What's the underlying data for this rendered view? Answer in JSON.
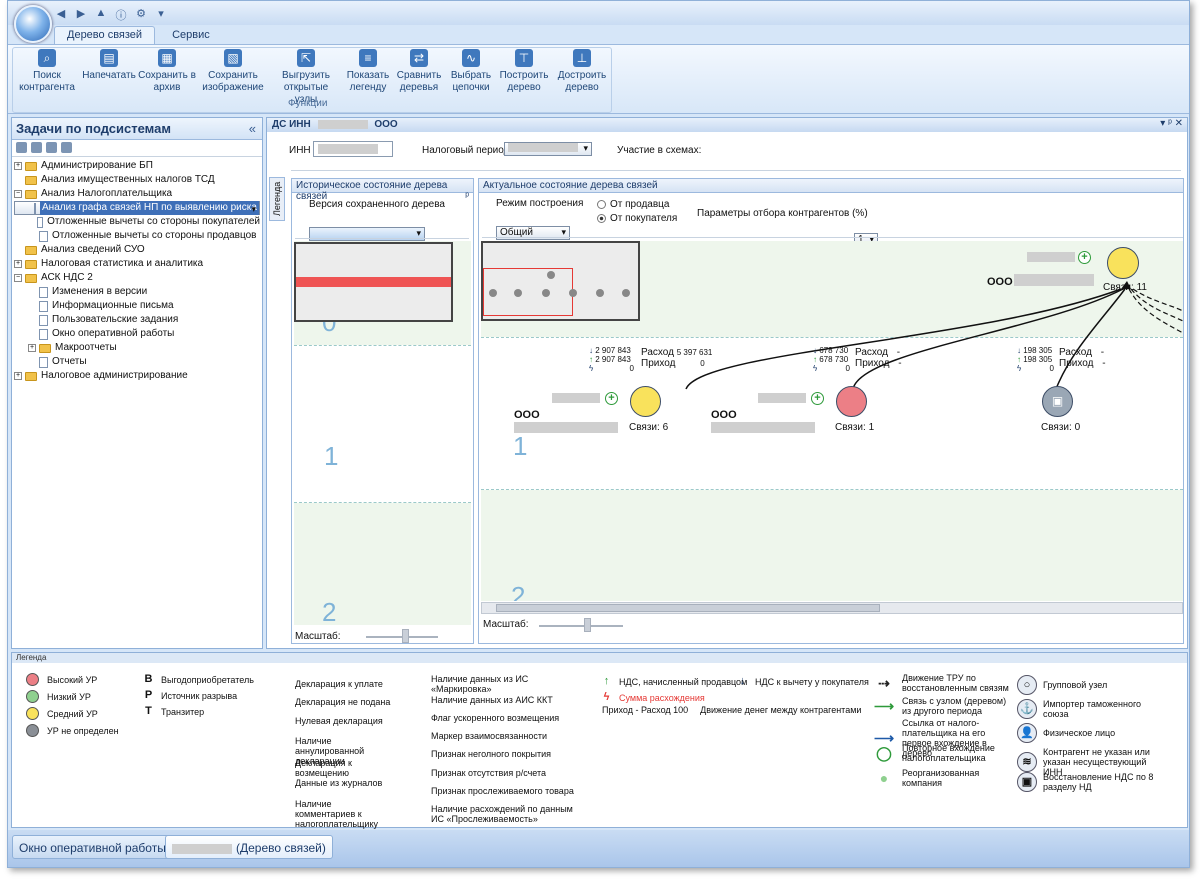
{
  "ribbon": {
    "tabs": [
      "Дерево связей",
      "Сервис"
    ],
    "buttons": [
      {
        "label": "Поиск контрагента",
        "icon": "search-icon"
      },
      {
        "label": "Напечатать",
        "icon": "print-icon"
      },
      {
        "label": "Сохранить в архив",
        "icon": "archive-icon"
      },
      {
        "label": "Сохранить изображение",
        "icon": "image-icon"
      },
      {
        "label": "Выгрузить открытые узлы",
        "icon": "export-nodes-icon"
      },
      {
        "label": "Показать легенду",
        "icon": "legend-icon"
      },
      {
        "label": "Сравнить деревья",
        "icon": "compare-icon"
      },
      {
        "label": "Выбрать цепочки",
        "icon": "chain-icon"
      },
      {
        "label": "Построить дерево",
        "icon": "build-tree-icon"
      },
      {
        "label": "Достроить дерево",
        "icon": "extend-tree-icon"
      }
    ],
    "group_name": "Функции"
  },
  "sidebar": {
    "title": "Задачи по подсистемам",
    "collapse": "«",
    "tree": [
      {
        "label": "Администрирование БП",
        "level": 0,
        "type": "folder",
        "exp": "+"
      },
      {
        "label": "Анализ имущественных налогов ТСД",
        "level": 0,
        "type": "folder",
        "exp": ""
      },
      {
        "label": "Анализ Налогоплательщика",
        "level": 0,
        "type": "folder",
        "exp": "−"
      },
      {
        "label": "Анализ графа связей НП по выявлению риска",
        "level": 1,
        "type": "doc",
        "exp": "",
        "selected": true
      },
      {
        "label": "Отложенные вычеты со стороны покупателей",
        "level": 1,
        "type": "doc",
        "exp": ""
      },
      {
        "label": "Отложенные вычеты со стороны продавцов",
        "level": 1,
        "type": "doc",
        "exp": ""
      },
      {
        "label": "Анализ сведений СУО",
        "level": 0,
        "type": "folder",
        "exp": ""
      },
      {
        "label": "Налоговая статистика и аналитика",
        "level": 0,
        "type": "folder",
        "exp": "+"
      },
      {
        "label": "АСК НДС 2",
        "level": 0,
        "type": "folder",
        "exp": "−"
      },
      {
        "label": "Изменения в версии",
        "level": 1,
        "type": "doc",
        "exp": ""
      },
      {
        "label": "Информационные письма",
        "level": 1,
        "type": "doc",
        "exp": ""
      },
      {
        "label": "Пользовательские задания",
        "level": 1,
        "type": "doc",
        "exp": ""
      },
      {
        "label": "Окно оперативной работы",
        "level": 1,
        "type": "doc",
        "exp": ""
      },
      {
        "label": "Макроотчеты",
        "level": 1,
        "type": "folder",
        "exp": "+"
      },
      {
        "label": "Отчеты",
        "level": 1,
        "type": "doc",
        "exp": ""
      },
      {
        "label": "Налоговое администрирование",
        "level": 0,
        "type": "folder",
        "exp": "+"
      }
    ]
  },
  "document": {
    "title": "ДС ИНН",
    "title_org": "ООО",
    "controls": "▾ ᵖ ✕",
    "inn_label": "ИНН",
    "period_label": "Налоговый период",
    "schemes_label": "Участие в схемах:",
    "legend_tab": "Легенда",
    "history_title": "Историческое состояние дерева связей",
    "history_pin": "ᵖ",
    "saved_version_label": "Версия сохраненного дерева",
    "current_title": "Актуальное состояние дерева связей",
    "mode_label": "Режим построения",
    "mode_value": "Общий",
    "radio_seller": "От продавца",
    "radio_buyer": "От покупателя",
    "params_label": "Параметры отбора контрагентов (%)",
    "params_value": "1",
    "scale_label": "Масштаб:",
    "level_1": "1",
    "level_2": "2",
    "level_0": "0"
  },
  "graph": {
    "root": {
      "org": "ООО",
      "links": "Связи: 11",
      "color": "#f9e25c"
    },
    "nodes": [
      {
        "org": "ООО",
        "links": "Связи: 6",
        "color": "#f9e25c",
        "v1": "2 907 843",
        "v2": "2 907 843",
        "v3": "0",
        "rashod_label": "Расход",
        "prihod_label": "Приход",
        "rashod": "5 397 631",
        "prihod": "0"
      },
      {
        "org": "ООО",
        "links": "Связи: 1",
        "color": "#ec7f86",
        "v1": "678 730",
        "v2": "678 730",
        "v3": "0",
        "rashod_label": "Расход",
        "prihod_label": "Приход",
        "rashod": "-",
        "prihod": "-"
      },
      {
        "org": "",
        "links": "Связи: 0",
        "color": "#9aa7b5",
        "v1": "198 305",
        "v2": "198 305",
        "v3": "0",
        "rashod_label": "Расход",
        "prihod_label": "Приход",
        "rashod": "-",
        "prihod": "-"
      }
    ]
  },
  "legend": {
    "title": "Легенда",
    "risk": [
      {
        "label": "Высокий УР",
        "color": "#ec7f86"
      },
      {
        "label": "Низкий УР",
        "color": "#8fd08f"
      },
      {
        "label": "Средний УР",
        "color": "#f9e25c"
      },
      {
        "label": "УР не определен",
        "color": "#8a8f96"
      }
    ],
    "roles": [
      {
        "letter": "B",
        "label": "Выгодоприобретатель"
      },
      {
        "letter": "P",
        "label": "Источник разрыва"
      },
      {
        "letter": "T",
        "label": "Транзитер"
      }
    ],
    "col3": [
      {
        "glyph": "⊕",
        "color": "#2e9a3a",
        "label": "Декларация к уплате"
      },
      {
        "glyph": "⊗",
        "color": "#222",
        "label": "Декларация не подана"
      },
      {
        "glyph": "⓪",
        "color": "#222",
        "label": "Нулевая декларация"
      },
      {
        "glyph": "⊗",
        "color": "#c0392b",
        "label": "Наличие аннулированной декларации"
      },
      {
        "glyph": "⊖",
        "color": "#d62b2b",
        "label": "Декларация к возмещению"
      },
      {
        "glyph": "▮",
        "color": "#333",
        "label": "Данные из журналов"
      },
      {
        "glyph": "●",
        "color": "#3a8ad8",
        "label": "Наличие комментариев к налогоплательщику"
      }
    ],
    "col4": [
      {
        "glyph": "●",
        "color": "#1e3d6b",
        "label": "Наличие данных из ИС «Маркировка»"
      },
      {
        "glyph": "◐",
        "color": "#1e3d6b",
        "label": "Наличие данных из АИС ККТ"
      },
      {
        "glyph": "⏩",
        "color": "#2e9a3a",
        "label": "Флаг ускоренного возмещения"
      },
      {
        "glyph": "◆",
        "color": "#1e3d6b",
        "label": "Маркер взаимосвязанности"
      },
      {
        "glyph": "▣",
        "color": "#1e3d6b",
        "label": "Признак неголного покрытия"
      },
      {
        "glyph": "₽",
        "color": "#c0392b",
        "label": "Признак отсутствия р/счета"
      },
      {
        "glyph": "⇆",
        "color": "#1e3d6b",
        "label": "Признак прослеживаемого товара"
      },
      {
        "glyph": "≠",
        "color": "#1e3d6b",
        "label": "Наличие расхождений по данным ИС «Прослеживаемость»"
      }
    ],
    "vat_seller": "НДС, начисленный продавцом",
    "vat_buyer": "НДС к вычету у покупателя",
    "diff_sum": "Сумма расхождения",
    "money_flow_prefix": "Приход  -  Расход 100",
    "money_flow": "Движение денег между контрагентами",
    "col6": [
      {
        "label": "Движение ТРУ по восстановленным связям",
        "color": "#222"
      },
      {
        "label": "Связь с узлом (деревом) из другого периода",
        "color": "#2e9a3a"
      },
      {
        "label": "Ссылка от налого-плательщика на его первое вхождение в дерево",
        "color": "#1e5aa8"
      },
      {
        "label": "Повторное вхождение налогоплательщика",
        "color": "#2e9a3a"
      },
      {
        "label": "Реорганизованная компания",
        "color": "#8fd08f"
      }
    ],
    "col7": [
      {
        "label": "Групповой узел",
        "icon": "group-node-icon"
      },
      {
        "label": "Импортер таможенного союза",
        "icon": "importer-icon"
      },
      {
        "label": "Физическое лицо",
        "icon": "person-icon"
      },
      {
        "label": "Контрагент не указан или указан несуществующий ИНН",
        "icon": "unknown-counterparty-icon"
      },
      {
        "label": "Восстановление НДС по 8 разделу НД",
        "icon": "vat-restore-icon"
      }
    ]
  },
  "taskbar": {
    "items": [
      "Окно оперативной работы",
      "(Дерево связей)"
    ]
  }
}
